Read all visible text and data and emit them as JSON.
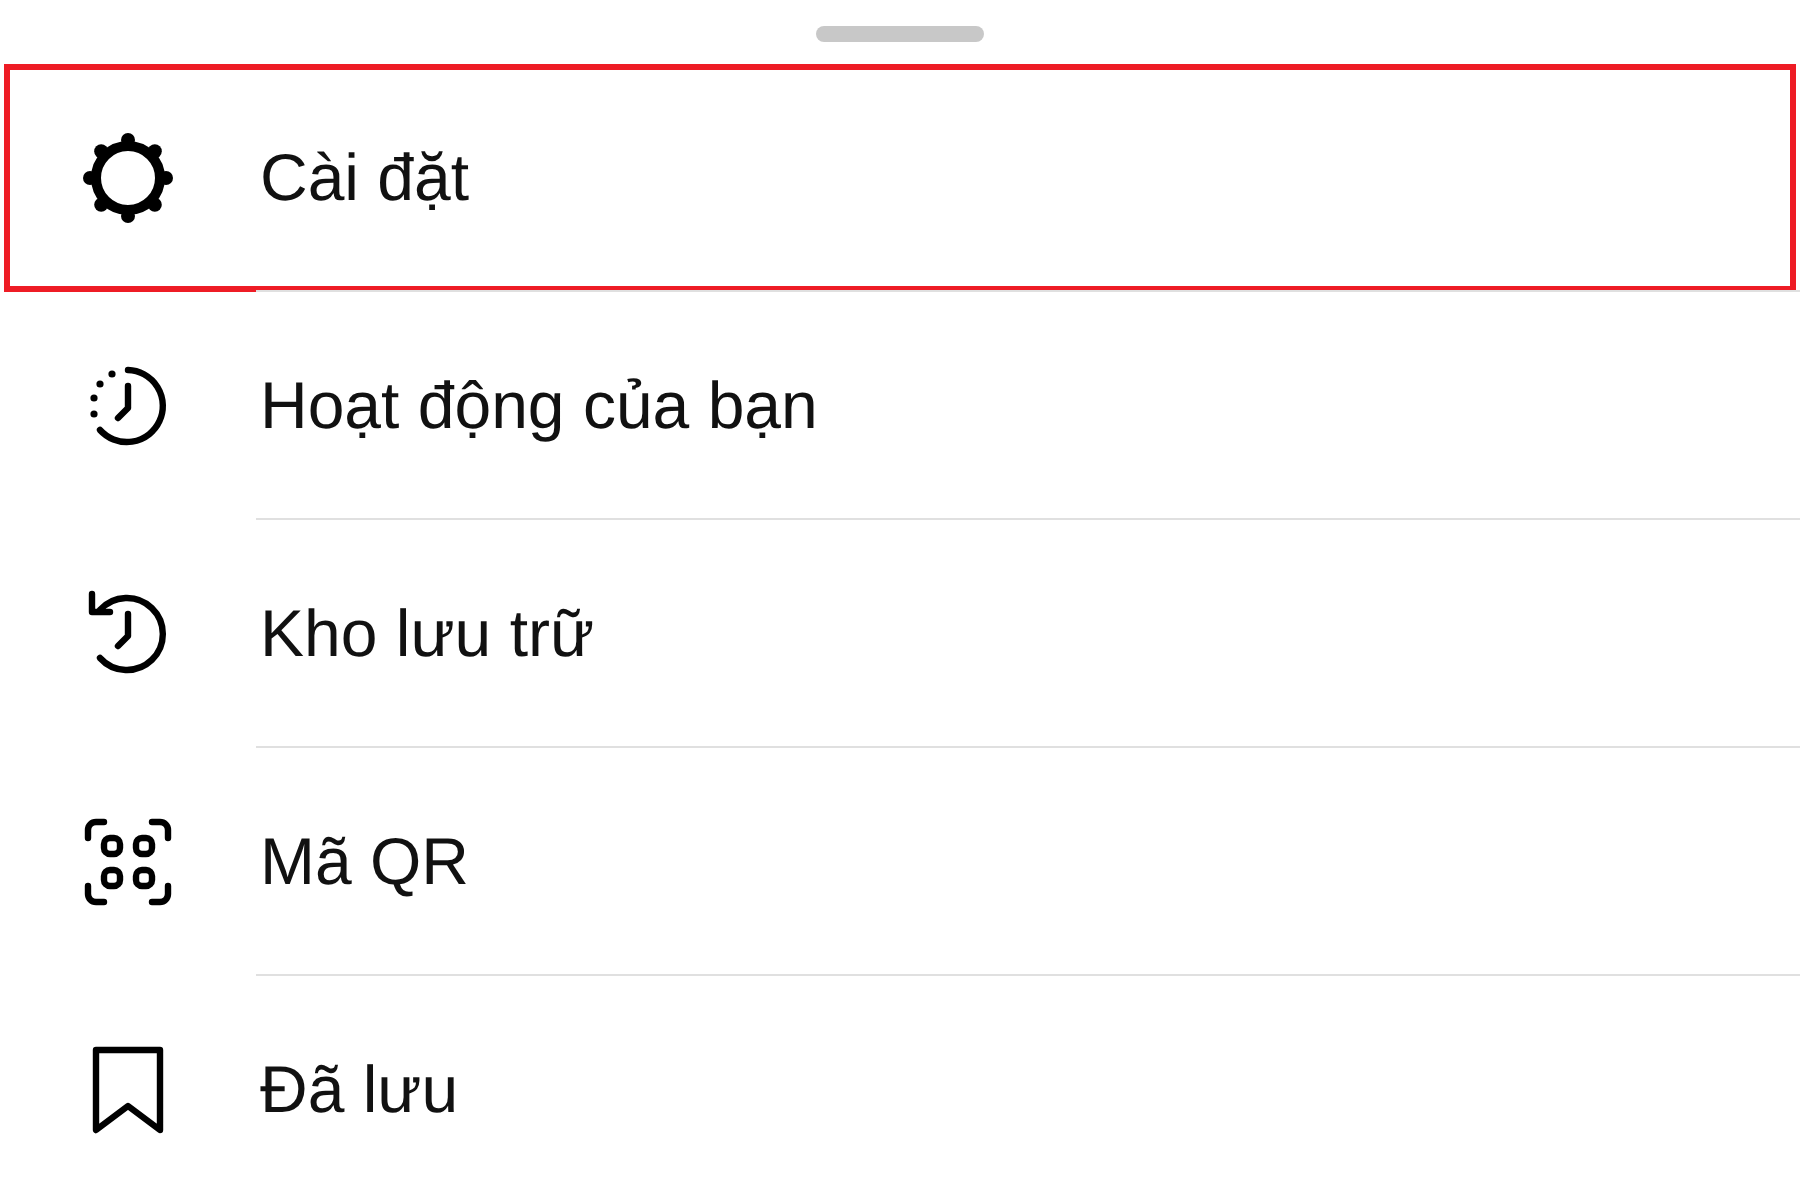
{
  "sheet": {
    "items": [
      {
        "kind": "settings",
        "label": "Cài đặt",
        "highlighted": true
      },
      {
        "kind": "activity",
        "label": "Hoạt động của bạn",
        "highlighted": false
      },
      {
        "kind": "archive",
        "label": "Kho lưu trữ",
        "highlighted": false
      },
      {
        "kind": "qr",
        "label": "Mã QR",
        "highlighted": false
      },
      {
        "kind": "saved",
        "label": "Đã lưu",
        "highlighted": false
      }
    ]
  }
}
